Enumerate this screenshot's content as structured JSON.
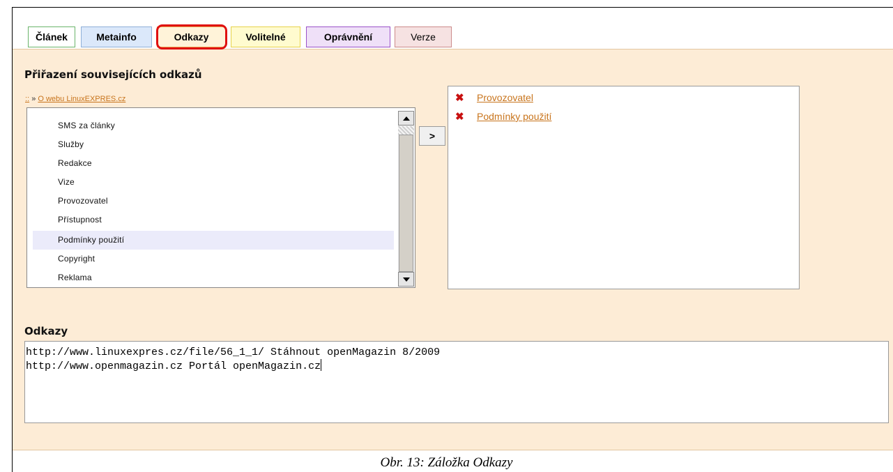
{
  "tabs": [
    {
      "label": "Článek",
      "color": "#6ab46a"
    },
    {
      "label": "Metainfo",
      "color": "#8fb0d8"
    },
    {
      "label": "Odkazy",
      "color": "#e8a050",
      "active": true
    },
    {
      "label": "Volitelné",
      "color": "#e6d24a"
    },
    {
      "label": "Oprávnění",
      "color": "#9a52c8"
    },
    {
      "label": "Verze",
      "color": "#cc8a8a"
    }
  ],
  "assign": {
    "title": "Přiřazení souvisejících odkazů",
    "breadcrumb": {
      "root": "::",
      "separator": "»",
      "current": "O webu LinuxEXPRES.cz"
    },
    "items": [
      "SMS za články",
      "Služby",
      "Redakce",
      "Vize",
      "Provozovatel",
      "Přístupnost",
      "Podmínky použití",
      "Copyright",
      "Reklama"
    ],
    "selected_item": "Podmínky použití",
    "move_button": ">",
    "assigned": [
      "Provozovatel",
      "Podmínky použití"
    ]
  },
  "links": {
    "title": "Odkazy",
    "lines": [
      "http://www.linuxexpres.cz/file/56_1_1/ Stáhnout openMagazin 8/2009",
      "http://www.openmagazin.cz Portál openMagazin.cz"
    ]
  },
  "caption": "Obr. 13: Záložka Odkazy",
  "colors": {
    "panel": "#fdecd6",
    "link": "#c8741c",
    "remove": "#c81010",
    "highlight": "#e01010"
  }
}
